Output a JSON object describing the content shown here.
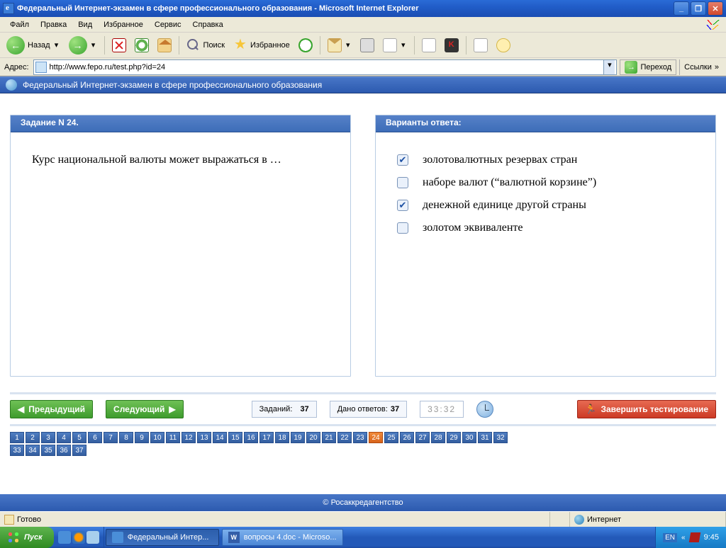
{
  "window": {
    "title": "Федеральный Интернет-экзамен в сфере профессионального образования - Microsoft Internet Explorer"
  },
  "menu": {
    "items": [
      "Файл",
      "Правка",
      "Вид",
      "Избранное",
      "Сервис",
      "Справка"
    ]
  },
  "toolbar": {
    "back": "Назад",
    "search": "Поиск",
    "favorites": "Избранное"
  },
  "address": {
    "label": "Адрес:",
    "url": "http://www.fepo.ru/test.php?id=24",
    "go": "Переход",
    "links": "Ссылки"
  },
  "page": {
    "header": "Федеральный Интернет-экзамен в сфере профессионального образования",
    "task_title": "Задание N 24.",
    "answers_title": "Варианты ответа:",
    "question": "Курс национальной валюты может выражаться в …",
    "options": [
      {
        "text": "золотовалютных резервах стран",
        "checked": true
      },
      {
        "text": "наборе валют (“валютной корзине”)",
        "checked": false
      },
      {
        "text": "денежной единице другой страны",
        "checked": true
      },
      {
        "text": "золотом эквиваленте",
        "checked": false
      }
    ],
    "prev": "Предыдущий",
    "next": "Следующий",
    "tasks_label": "Заданий:",
    "tasks_count": "37",
    "answered_label": "Дано ответов:",
    "answered_count": "37",
    "timer": "33:32",
    "finish": "Завершить тестирование",
    "total_questions": 37,
    "current_question": 24,
    "footer": "© Росаккредагентство"
  },
  "statusbar": {
    "ready": "Готово",
    "zone": "Интернет"
  },
  "taskbar": {
    "start": "Пуск",
    "task1": "Федеральный Интер...",
    "task2": "вопросы 4.doc - Microso...",
    "lang": "EN",
    "time": "9:45"
  }
}
